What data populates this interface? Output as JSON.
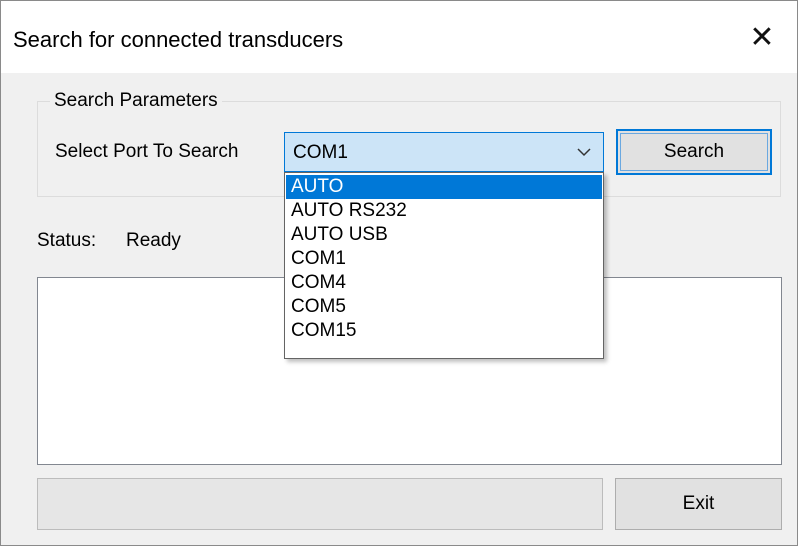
{
  "window": {
    "title": "Search for connected transducers",
    "close_glyph": "✕"
  },
  "search_parameters": {
    "legend": "Search Parameters",
    "port_label": "Select Port To Search",
    "port_selected": "COM1",
    "search_button": "Search",
    "dropdown_options": [
      "AUTO",
      "AUTO RS232",
      "AUTO USB",
      "COM1",
      "COM4",
      "COM5",
      "COM15"
    ],
    "highlighted_option": "AUTO"
  },
  "status": {
    "label": "Status:",
    "value": "Ready"
  },
  "results_list": [],
  "progress": {
    "fraction": 0
  },
  "footer": {
    "exit_button": "Exit"
  },
  "colors": {
    "accent": "#0078d7",
    "combo_bg": "#cce4f7",
    "window_bg": "#f0f0f0"
  }
}
